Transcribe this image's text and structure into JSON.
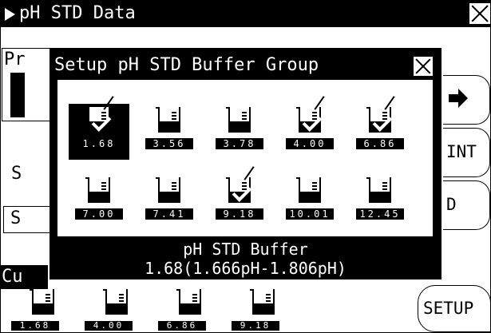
{
  "window": {
    "title": "pH STD Data"
  },
  "background": {
    "label_pr": "Pr",
    "label_s1": "S",
    "label_s2": "S",
    "label_cu": "Cu"
  },
  "side_buttons": {
    "next_icon": "arrow-right-icon",
    "int_label": "INT",
    "d_label": "D",
    "setup_label": "SETUP"
  },
  "bottom_beakers": [
    {
      "value": "1.68"
    },
    {
      "value": "4.00"
    },
    {
      "value": "6.86"
    },
    {
      "value": "9.18"
    }
  ],
  "dialog": {
    "title": "Setup pH STD Buffer Group",
    "buffers": [
      {
        "value": "1.68",
        "checked": true,
        "selected": true
      },
      {
        "value": "3.56",
        "checked": false,
        "selected": false
      },
      {
        "value": "3.78",
        "checked": false,
        "selected": false
      },
      {
        "value": "4.00",
        "checked": true,
        "selected": false
      },
      {
        "value": "6.86",
        "checked": true,
        "selected": false
      },
      {
        "value": "7.00",
        "checked": false,
        "selected": false
      },
      {
        "value": "7.41",
        "checked": false,
        "selected": false
      },
      {
        "value": "9.18",
        "checked": true,
        "selected": false
      },
      {
        "value": "10.01",
        "checked": false,
        "selected": false
      },
      {
        "value": "12.45",
        "checked": false,
        "selected": false
      }
    ],
    "status_line1": "pH STD Buffer",
    "status_line2": "1.68(1.666pH-1.806pH)"
  }
}
